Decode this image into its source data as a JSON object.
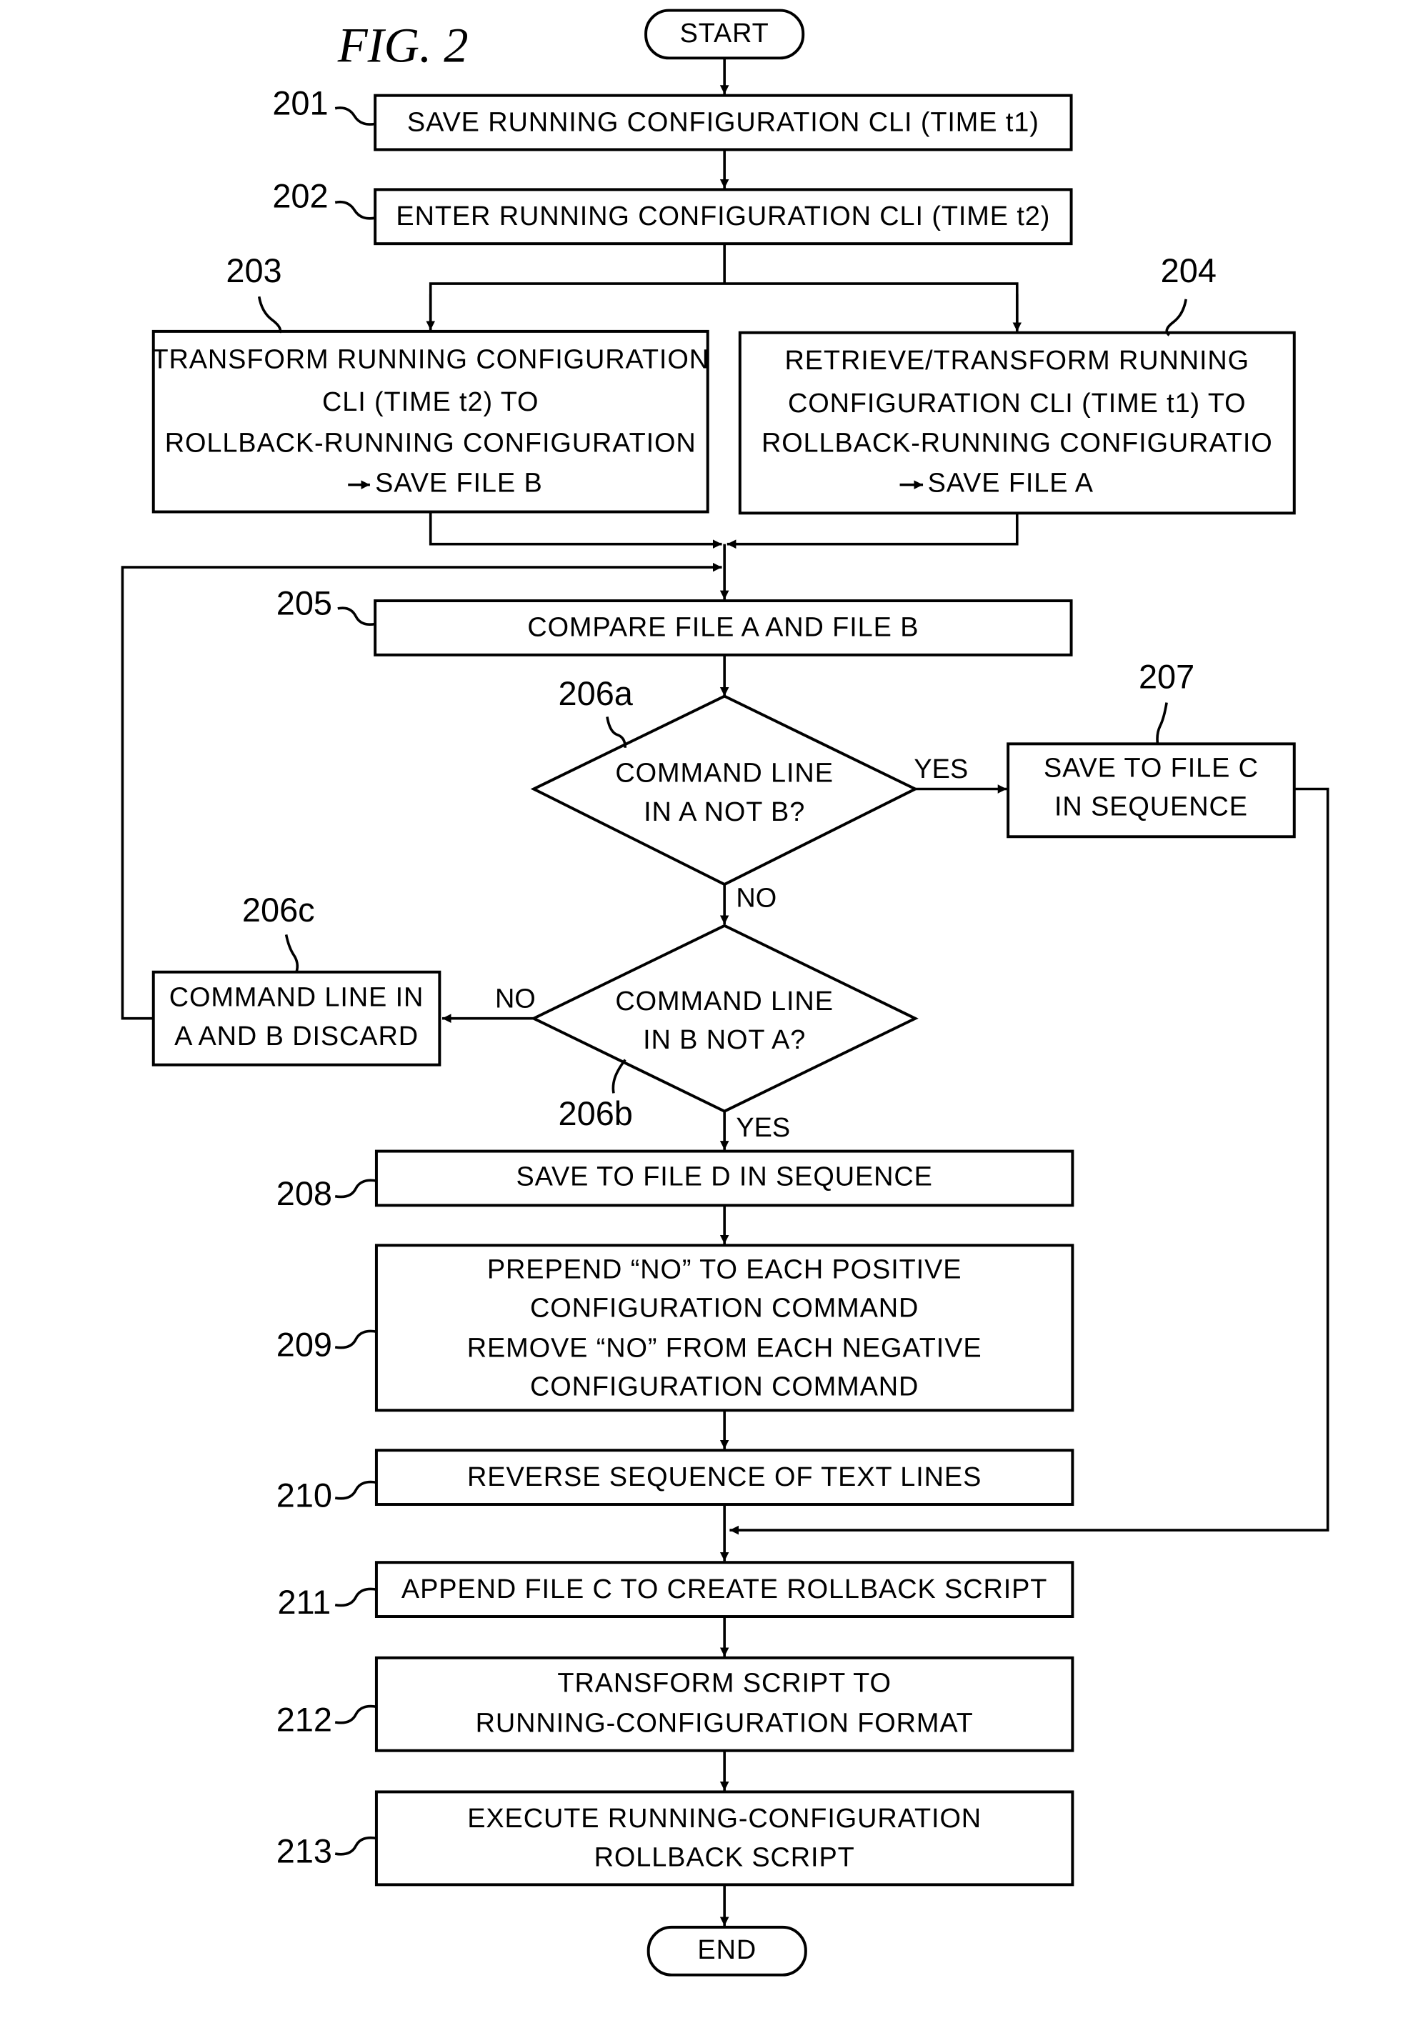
{
  "figure_title": "FIG. 2",
  "start_label": "START",
  "end_label": "END",
  "steps": {
    "s201": {
      "ref": "201",
      "lines": [
        "SAVE RUNNING CONFIGURATION CLI (TIME t1)"
      ]
    },
    "s202": {
      "ref": "202",
      "lines": [
        "ENTER RUNNING CONFIGURATION CLI (TIME t2)"
      ]
    },
    "s203": {
      "ref": "203",
      "lines": [
        "TRANSFORM RUNNING CONFIGURATION",
        "CLI (TIME t2) TO",
        "ROLLBACK-RUNNING CONFIGURATION",
        "SAVE FILE B"
      ]
    },
    "s204": {
      "ref": "204",
      "lines": [
        "RETRIEVE/TRANSFORM RUNNING",
        "CONFIGURATION CLI (TIME t1) TO",
        "ROLLBACK-RUNNING CONFIGURATIO",
        "SAVE FILE A"
      ]
    },
    "s205": {
      "ref": "205",
      "lines": [
        "COMPARE FILE A AND FILE B"
      ]
    },
    "s206a": {
      "ref": "206a",
      "lines": [
        "COMMAND LINE",
        "IN A NOT B?"
      ]
    },
    "s206b": {
      "ref": "206b",
      "lines": [
        "COMMAND LINE",
        "IN B NOT A?"
      ]
    },
    "s206c": {
      "ref": "206c",
      "lines": [
        "COMMAND LINE IN",
        "A AND B DISCARD"
      ]
    },
    "s207": {
      "ref": "207",
      "lines": [
        "SAVE TO FILE C",
        "IN SEQUENCE"
      ]
    },
    "s208": {
      "ref": "208",
      "lines": [
        "SAVE TO FILE D IN SEQUENCE"
      ]
    },
    "s209": {
      "ref": "209",
      "lines": [
        "PREPEND “NO” TO EACH POSITIVE",
        "CONFIGURATION COMMAND",
        "REMOVE “NO” FROM EACH NEGATIVE",
        "CONFIGURATION COMMAND"
      ]
    },
    "s210": {
      "ref": "210",
      "lines": [
        "REVERSE SEQUENCE OF TEXT LINES"
      ]
    },
    "s211": {
      "ref": "211",
      "lines": [
        "APPEND FILE C TO CREATE ROLLBACK SCRIPT"
      ]
    },
    "s212": {
      "ref": "212",
      "lines": [
        "TRANSFORM SCRIPT TO",
        "RUNNING-CONFIGURATION FORMAT"
      ]
    },
    "s213": {
      "ref": "213",
      "lines": [
        "EXECUTE RUNNING-CONFIGURATION",
        "ROLLBACK SCRIPT"
      ]
    }
  },
  "edge_labels": {
    "a_yes": "YES",
    "a_no": "NO",
    "b_no": "NO",
    "b_yes": "YES"
  }
}
